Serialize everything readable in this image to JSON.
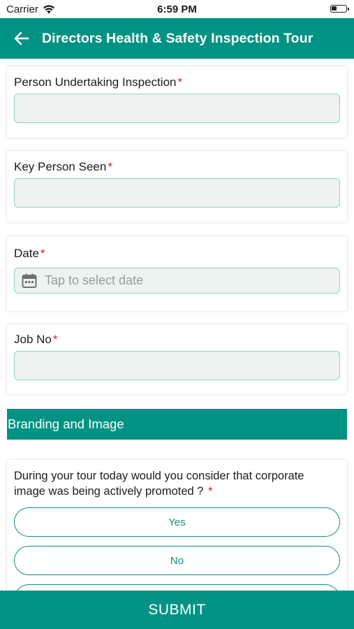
{
  "status_bar": {
    "carrier": "Carrier",
    "time": "6:59 PM",
    "battery_level": 0.35
  },
  "header": {
    "title": "Directors Health & Safety Inspection Tour"
  },
  "fields": [
    {
      "label": "Person Undertaking Inspection",
      "required_mark": "*",
      "value": ""
    },
    {
      "label": "Key Person Seen",
      "required_mark": "*",
      "value": ""
    },
    {
      "label": "Date",
      "required_mark": "*",
      "placeholder": "Tap to select date"
    },
    {
      "label": "Job No",
      "required_mark": "*",
      "value": ""
    }
  ],
  "section": {
    "title": "Branding and Image"
  },
  "question": {
    "text": "During your tour today would you consider that corporate image was being actively promoted ?",
    "required_mark": "*",
    "options": [
      "Yes",
      "No"
    ]
  },
  "submit": {
    "label": "SUBMIT"
  },
  "colors": {
    "accent": "#009383",
    "required": "#e0191c",
    "input_bg": "#eef2f1",
    "input_border": "#8fd3c9"
  }
}
